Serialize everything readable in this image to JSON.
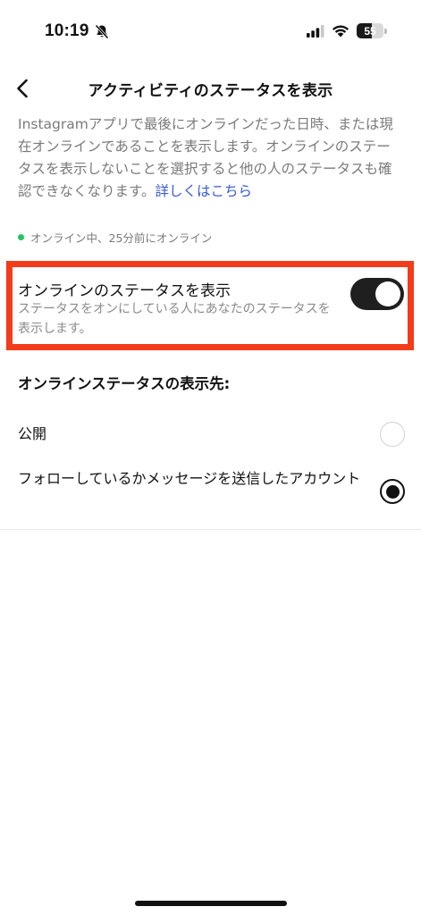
{
  "status_bar": {
    "time": "10:19",
    "battery_level": "55",
    "battery_fraction": 0.55
  },
  "header": {
    "title": "アクティビティのステータスを表示",
    "back_icon": "chevron-left-icon"
  },
  "description": {
    "text": "Instagramアプリで最後にオンラインだった日時、または現在オンラインであることを表示します。オンラインのステータスを表示しないことを選択すると他の人のステータスも確認できなくなります。",
    "link_text": "詳しくはこちら"
  },
  "online_status": {
    "text": "オンライン中、25分前にオンライン"
  },
  "toggle": {
    "title": "オンラインのステータスを表示",
    "subtitle": "ステータスをオンにしている人にあなたのステータスを表示します。",
    "enabled": true
  },
  "visibility": {
    "heading": "オンラインステータスの表示先:",
    "options": [
      {
        "label": "公開",
        "selected": false
      },
      {
        "label": "フォローしているかメッセージを送信したアカウント",
        "selected": true
      }
    ]
  },
  "colors": {
    "highlight": "#f23c1a",
    "link": "#3b5bd6",
    "online_dot": "#22c55e",
    "toggle_on": "#1f1f1f"
  }
}
